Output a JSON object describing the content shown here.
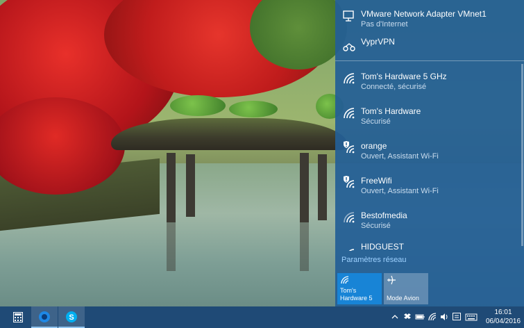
{
  "flyout": {
    "top_items": [
      {
        "name": "VMware Network Adapter VMnet1",
        "status": "Pas d'Internet",
        "icon": "ethernet-monitor-icon"
      },
      {
        "name": "VyprVPN",
        "status": "",
        "icon": "vpn-icon"
      }
    ],
    "networks": [
      {
        "name": "Tom's Hardware 5 GHz",
        "status": "Connecté, sécurisé",
        "icon": "wifi-icon",
        "open": false
      },
      {
        "name": "Tom's Hardware",
        "status": "Sécurisé",
        "icon": "wifi-icon",
        "open": false
      },
      {
        "name": "orange",
        "status": "Ouvert, Assistant Wi-Fi",
        "icon": "wifi-shield-icon",
        "open": true
      },
      {
        "name": "FreeWifi",
        "status": "Ouvert, Assistant Wi-Fi",
        "icon": "wifi-shield-icon",
        "open": true
      },
      {
        "name": "Bestofmedia",
        "status": "Sécurisé",
        "icon": "wifi-icon",
        "open": false
      },
      {
        "name": "HIDGUEST",
        "status": "",
        "icon": "wifi-icon",
        "open": false
      }
    ],
    "settings_link": "Paramètres réseau",
    "tiles": [
      {
        "label_line1": "Tom's",
        "label_line2": "Hardware 5",
        "icon": "wifi-icon",
        "active": true
      },
      {
        "label_line1": "",
        "label_line2": "Mode Avion",
        "icon": "airplane-icon",
        "active": false
      }
    ]
  },
  "taskbar": {
    "apps": [
      {
        "icon": "calculator-icon",
        "active": false
      },
      {
        "icon": "browser-icon",
        "active": true
      },
      {
        "icon": "skype-icon",
        "active": true
      }
    ],
    "tray": [
      "chevron-up-icon",
      "dropbox-icon",
      "battery-icon",
      "wifi-icon",
      "volume-icon",
      "action-center-icon",
      "keyboard-icon"
    ],
    "time": "16:01",
    "date": "06/04/2016"
  },
  "colors": {
    "flyout_bg": "#235f96",
    "accent": "#1884d6",
    "taskbar_bg": "#1f4a76",
    "link": "#9ed2ff"
  }
}
